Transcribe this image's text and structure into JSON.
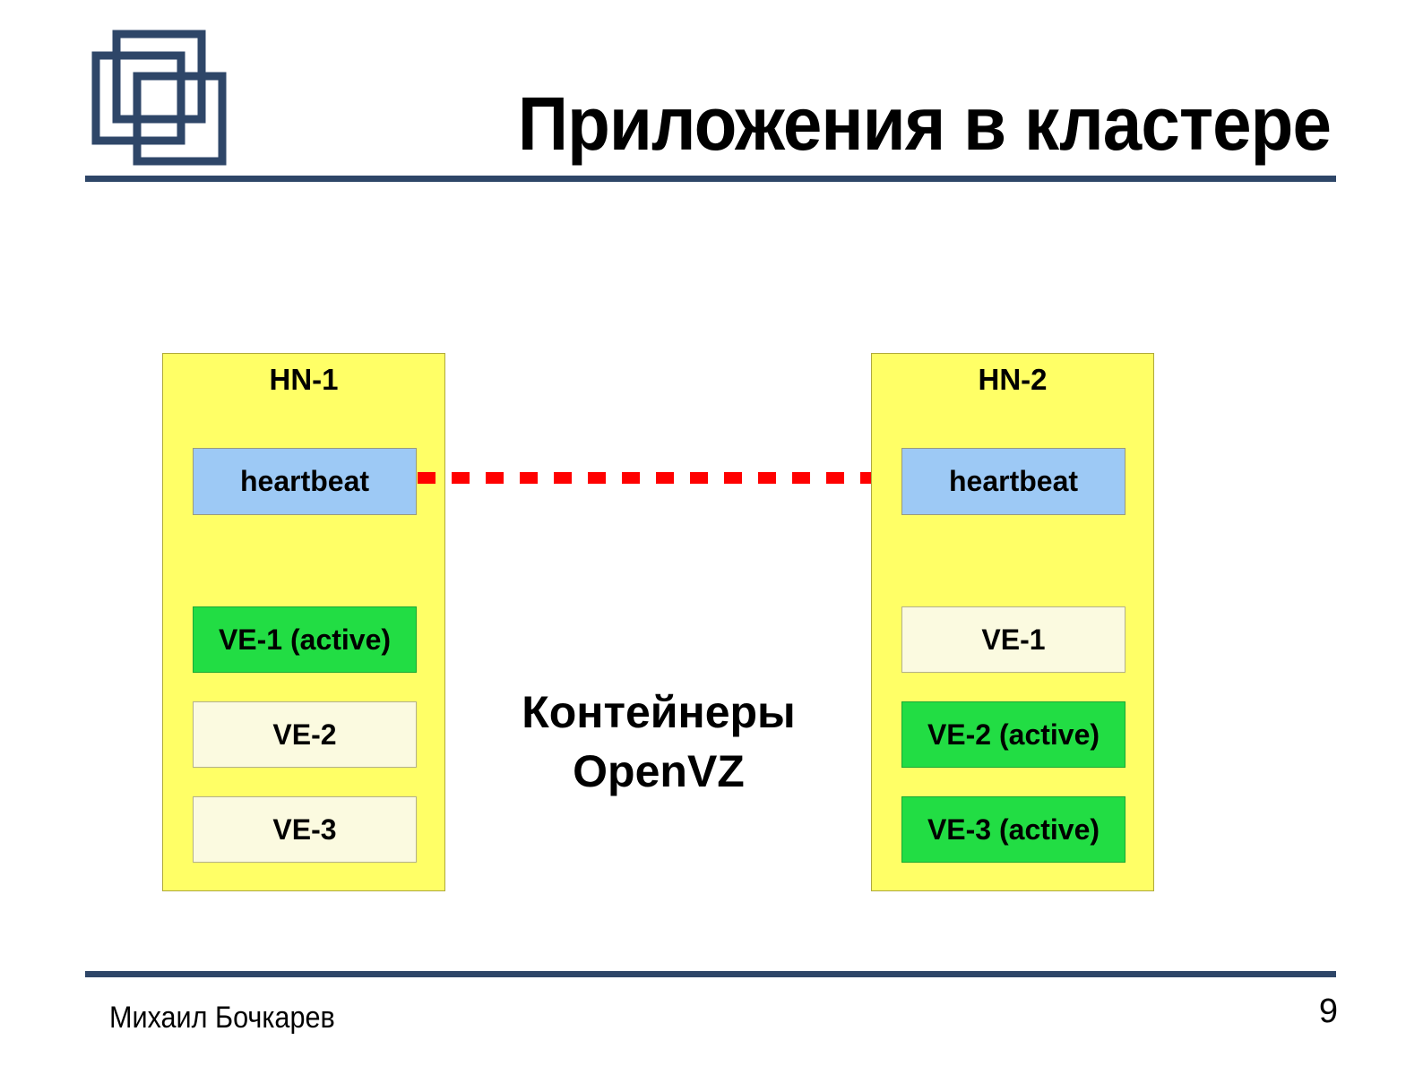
{
  "header": {
    "title": "Приложения в кластере",
    "logo_icon": "overlapping-squares-logo",
    "rule_color": "#2E4668"
  },
  "diagram": {
    "caption_line_1": "Контейнеры",
    "caption_line_2": "OpenVZ",
    "link_icon": "red-dashed-heartbeat-link",
    "colors": {
      "panel": "#FFFF66",
      "heartbeat": "#9DC9F5",
      "active": "#22DD44",
      "inactive": "#FBFAE0",
      "link": "#FF0000"
    },
    "nodes": [
      {
        "title": "HN-1",
        "heartbeat_label": "heartbeat",
        "containers": [
          {
            "label": "VE-1 (active)",
            "state": "active"
          },
          {
            "label": "VE-2",
            "state": "inactive"
          },
          {
            "label": "VE-3",
            "state": "inactive"
          }
        ]
      },
      {
        "title": "HN-2",
        "heartbeat_label": "heartbeat",
        "containers": [
          {
            "label": "VE-1",
            "state": "inactive"
          },
          {
            "label": "VE-2 (active)",
            "state": "active"
          },
          {
            "label": "VE-3 (active)",
            "state": "active"
          }
        ]
      }
    ]
  },
  "footer": {
    "author": "Михаил Бочкарев",
    "page_number": "9"
  }
}
